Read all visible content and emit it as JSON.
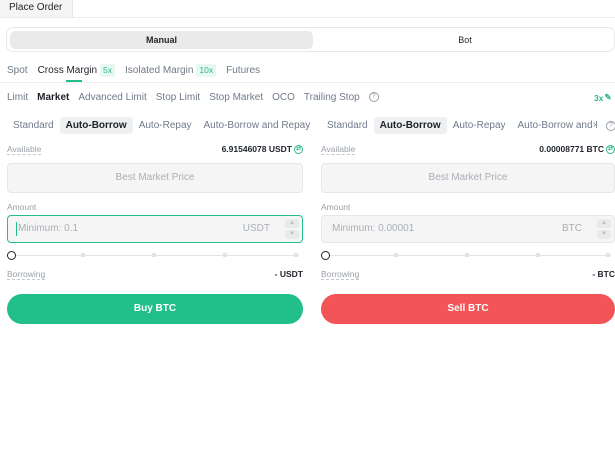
{
  "header": {
    "tab_label": "Place Order"
  },
  "mode": {
    "manual": "Manual",
    "bot": "Bot"
  },
  "market_tabs": [
    {
      "label": "Spot"
    },
    {
      "label": "Cross Margin",
      "badge": "5x"
    },
    {
      "label": "Isolated Margin",
      "badge": "10x"
    },
    {
      "label": "Futures"
    }
  ],
  "order_types": [
    "Limit",
    "Market",
    "Advanced Limit",
    "Stop Limit",
    "Stop Market",
    "OCO",
    "Trailing Stop"
  ],
  "info_icon_glyph": "?",
  "leverage": {
    "value": "3x",
    "icon": "edit-icon"
  },
  "buy_panel": {
    "borrow_modes": [
      "Standard",
      "Auto-Borrow",
      "Auto-Repay",
      "Auto-Borrow and Repay"
    ],
    "available_label": "Available",
    "available_value": "6.91546078 USDT",
    "price_placeholder": "Best Market Price",
    "amount_label": "Amount",
    "amount_placeholder": "Minimum: 0.1",
    "amount_unit": "USDT",
    "borrowing_label": "Borrowing",
    "borrowing_value": "- USDT",
    "action_label": "Buy BTC"
  },
  "sell_panel": {
    "borrow_modes": [
      "Standard",
      "Auto-Borrow",
      "Auto-Repay",
      "Auto-Borrow and R"
    ],
    "available_label": "Available",
    "available_value": "0.00008771 BTC",
    "price_placeholder": "Best Market Price",
    "amount_label": "Amount",
    "amount_placeholder": "Minimum: 0.00001",
    "amount_unit": "BTC",
    "borrowing_label": "Borrowing",
    "borrowing_value": "- BTC",
    "action_label": "Sell BTC"
  },
  "colors": {
    "buy": "#21c08a",
    "sell": "#f25458",
    "accent": "#2fb88a"
  },
  "glyphs": {
    "stepper_up": "▲",
    "stepper_down": "▼",
    "swap": "⇄",
    "chevron": "›",
    "edit": "✎"
  }
}
